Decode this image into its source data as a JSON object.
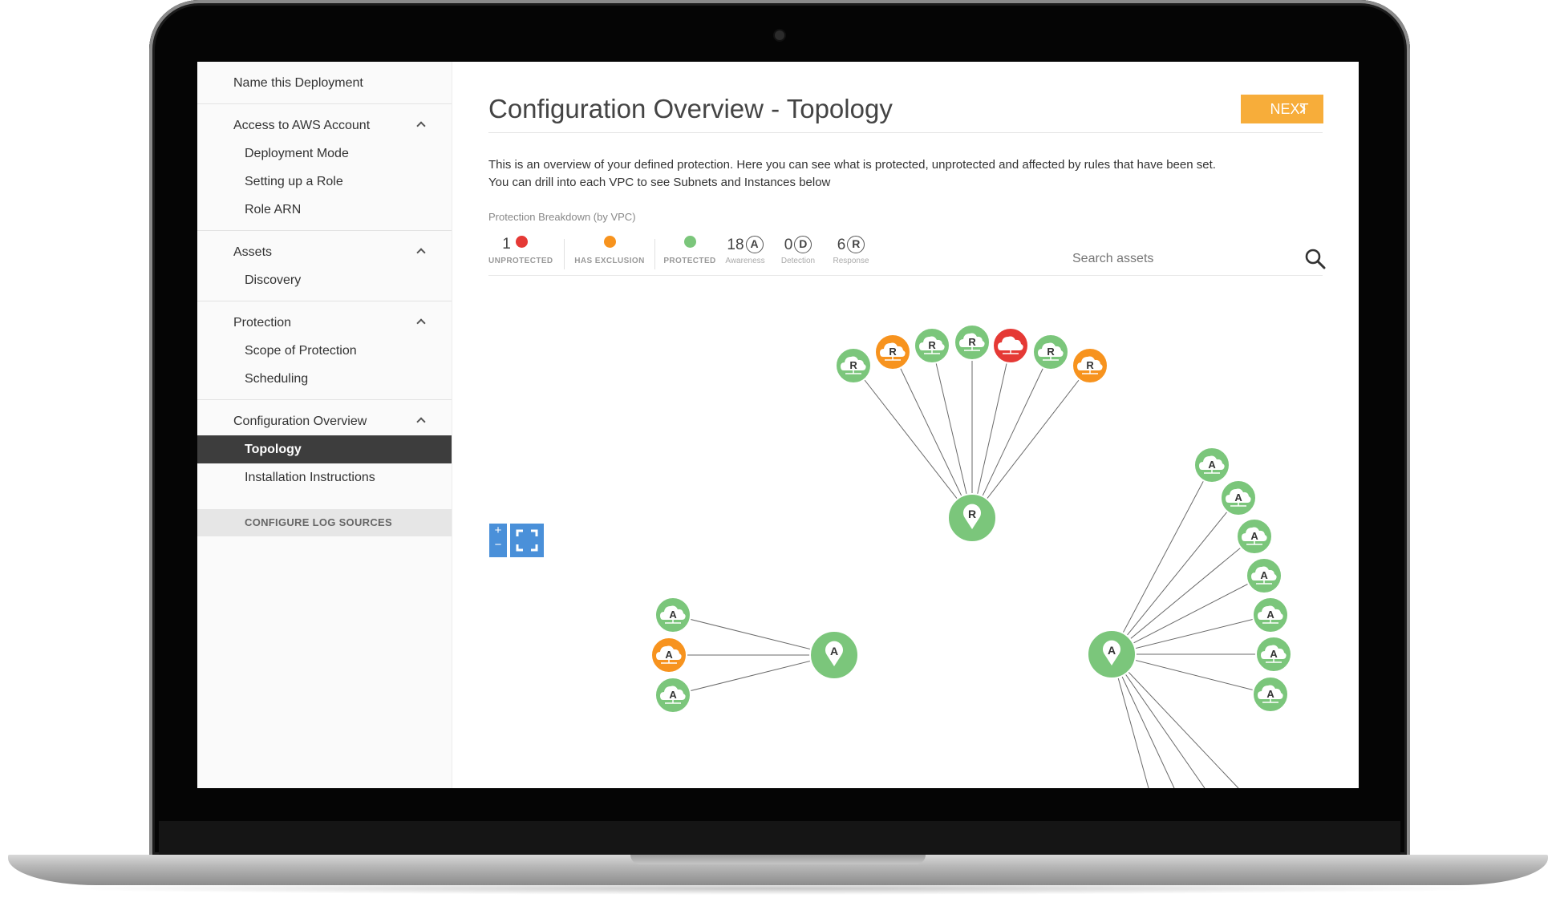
{
  "sidebar": {
    "top_item": "Name this Deployment",
    "sections": [
      {
        "title": "Access to AWS Account",
        "items": [
          "Deployment Mode",
          "Setting up a Role",
          "Role ARN"
        ]
      },
      {
        "title": "Assets",
        "items": [
          "Discovery"
        ]
      },
      {
        "title": "Protection",
        "items": [
          "Scope of Protection",
          "Scheduling"
        ]
      },
      {
        "title": "Configuration Overview",
        "items": [
          "Topology",
          "Installation Instructions"
        ],
        "active_index": 0
      }
    ],
    "cta": "CONFIGURE LOG SOURCES"
  },
  "main": {
    "title": "Configuration Overview - Topology",
    "next_label": "NEXT",
    "description_line1": "This is an overview of your defined protection. Here you can see what is protected, unprotected and affected by rules that have been set.",
    "description_line2": "You can drill into each VPC to see Subnets and Instances below",
    "breakdown_label": "Protection Breakdown (by VPC)",
    "stats": {
      "unprotected": {
        "count": "1",
        "label": "UNPROTECTED"
      },
      "has_exclusion": {
        "label": "HAS EXCLUSION"
      },
      "protected": {
        "label": "PROTECTED"
      },
      "awareness": {
        "count": "18",
        "letter": "A",
        "label": "Awareness"
      },
      "detection": {
        "count": "0",
        "letter": "D",
        "label": "Detection"
      },
      "response": {
        "count": "6",
        "letter": "R",
        "label": "Response"
      }
    },
    "search_placeholder": "Search assets",
    "zoom_in": "+",
    "zoom_out": "−"
  },
  "colors": {
    "green": "#7bc67b",
    "orange": "#f7931e",
    "red": "#e53935",
    "accent_blue": "#4a90d9",
    "next_orange": "#f7ad3a"
  },
  "topology": {
    "hubs": [
      {
        "id": "hub-top",
        "letter": "R",
        "status": "protected"
      },
      {
        "id": "hub-left",
        "letter": "A",
        "status": "protected"
      },
      {
        "id": "hub-right",
        "letter": "A",
        "status": "protected"
      }
    ],
    "top_children": [
      {
        "letter": "R",
        "status": "protected"
      },
      {
        "letter": "R",
        "status": "has-exclusion"
      },
      {
        "letter": "R",
        "status": "protected"
      },
      {
        "letter": "R",
        "status": "protected"
      },
      {
        "letter": "",
        "status": "unprotected"
      },
      {
        "letter": "R",
        "status": "protected"
      },
      {
        "letter": "R",
        "status": "has-exclusion"
      }
    ],
    "left_children": [
      {
        "letter": "A",
        "status": "protected"
      },
      {
        "letter": "A",
        "status": "has-exclusion"
      },
      {
        "letter": "A",
        "status": "protected"
      }
    ],
    "right_children": [
      {
        "letter": "A",
        "status": "protected"
      },
      {
        "letter": "A",
        "status": "protected"
      },
      {
        "letter": "A",
        "status": "protected"
      },
      {
        "letter": "A",
        "status": "protected"
      },
      {
        "letter": "A",
        "status": "protected"
      },
      {
        "letter": "A",
        "status": "protected"
      },
      {
        "letter": "A",
        "status": "protected"
      }
    ]
  }
}
